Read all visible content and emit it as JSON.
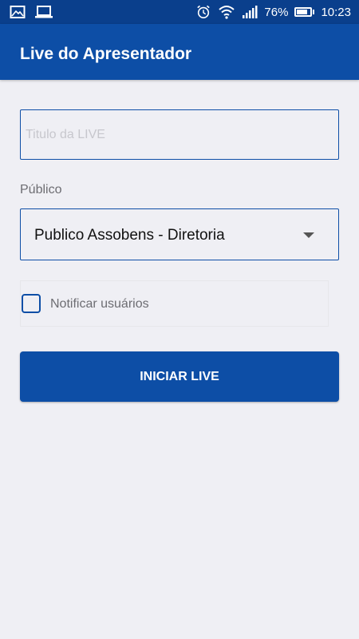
{
  "status_bar": {
    "battery_percent": "76%",
    "battery_level": 0.76,
    "time": "10:23",
    "icons": [
      "gallery-icon",
      "laptop-icon",
      "alarm-icon",
      "wifi-icon",
      "signal-icon",
      "battery-icon"
    ]
  },
  "app_bar": {
    "title": "Live do Apresentador"
  },
  "form": {
    "title_placeholder": "Titulo da LIVE",
    "title_value": "",
    "publico_label": "Público",
    "publico_selected": "Publico Assobens - Diretoria",
    "notify_label": "Notificar usuários",
    "notify_checked": false,
    "start_button_label": "INICIAR LIVE"
  },
  "colors": {
    "primary": "#0d4ea6",
    "status_bar": "#0a3f8c",
    "background": "#efeff4"
  }
}
